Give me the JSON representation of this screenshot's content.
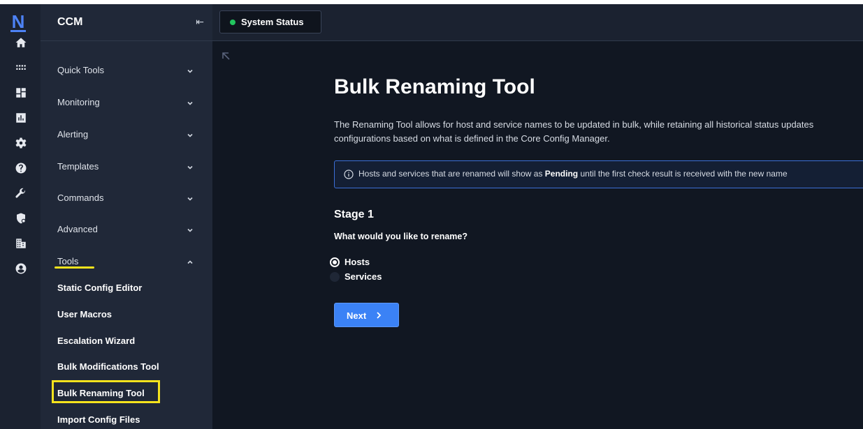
{
  "app": {
    "logo_letter": "N",
    "section_title": "CCM"
  },
  "topbar": {
    "status_label": "System Status",
    "status_color": "#22c55e"
  },
  "rail": {
    "icons": [
      "home-icon",
      "apps-grid-icon",
      "dashboard-icon",
      "reports-chart-icon",
      "gear-icon",
      "help-icon",
      "wrench-icon",
      "shield-user-icon",
      "building-icon",
      "user-circle-icon"
    ]
  },
  "nav": {
    "items": [
      {
        "label": "Quick Tools"
      },
      {
        "label": "Monitoring"
      },
      {
        "label": "Alerting"
      },
      {
        "label": "Templates"
      },
      {
        "label": "Commands"
      },
      {
        "label": "Advanced"
      },
      {
        "label": "Tools"
      }
    ],
    "tools_sub": [
      {
        "label": "Static Config Editor"
      },
      {
        "label": "User Macros"
      },
      {
        "label": "Escalation Wizard"
      },
      {
        "label": "Bulk Modifications Tool"
      },
      {
        "label": "Bulk Renaming Tool"
      },
      {
        "label": "Import Config Files"
      }
    ]
  },
  "main": {
    "title": "Bulk Renaming Tool",
    "description": "The Renaming Tool allows for host and service names to be updated in bulk, while retaining all historical status updates configurations based on what is defined in the Core Config Manager.",
    "info": {
      "prefix": "Hosts and services that are renamed will show as",
      "emphasis": "Pending",
      "suffix": "until the first check result is received with the new name"
    },
    "stage_title": "Stage 1",
    "question": "What would you like to rename?",
    "options": [
      {
        "label": "Hosts",
        "selected": true
      },
      {
        "label": "Services",
        "selected": false
      }
    ],
    "next_label": "Next"
  },
  "colors": {
    "accent": "#3b82f6",
    "highlight": "#f5e31d",
    "background": "#111722",
    "sidebar": "#202838"
  }
}
